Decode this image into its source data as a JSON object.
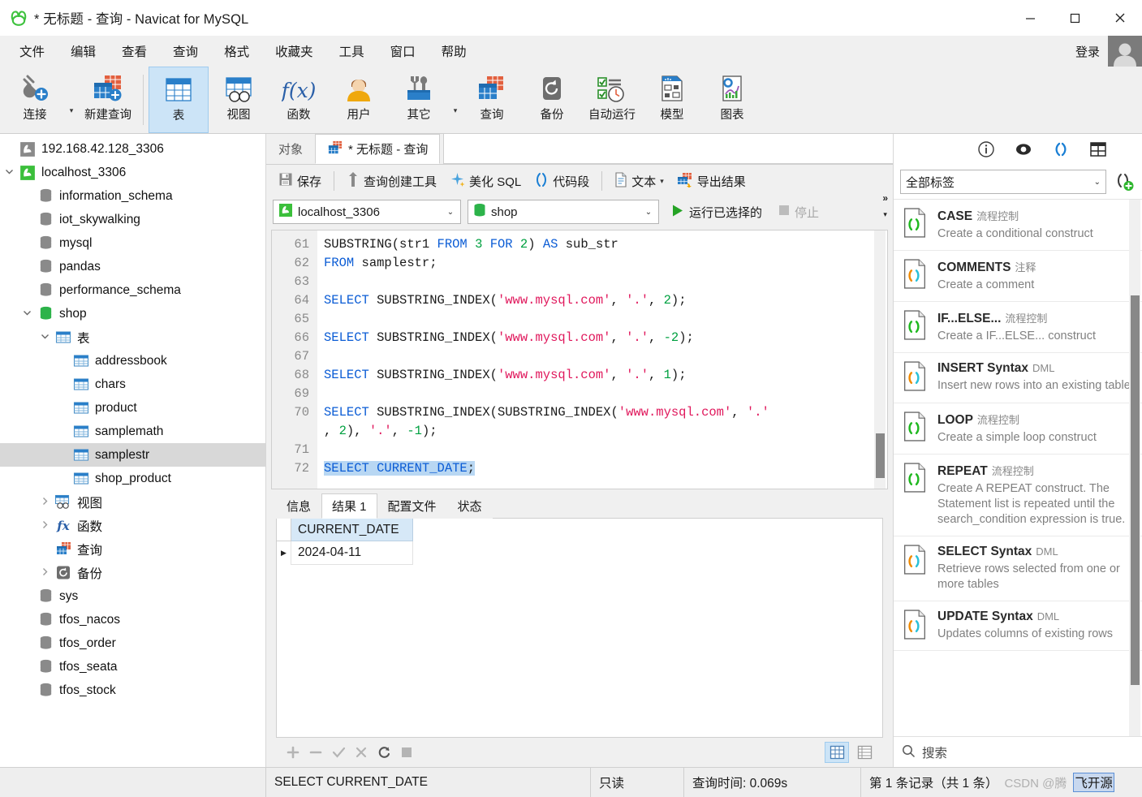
{
  "window": {
    "title": "* 无标题 - 查询 - Navicat for MySQL",
    "minimize": "—",
    "maximize": "□",
    "close": "✕"
  },
  "menubar": {
    "items": [
      "文件",
      "编辑",
      "查看",
      "查询",
      "格式",
      "收藏夹",
      "工具",
      "窗口",
      "帮助"
    ],
    "login_label": "登录"
  },
  "ribbon": {
    "buttons": [
      {
        "label": "连接",
        "icon": "connection-plug-icon"
      },
      {
        "label": "新建查询",
        "icon": "new-query-icon"
      },
      {
        "label": "表",
        "icon": "table-icon"
      },
      {
        "label": "视图",
        "icon": "view-icon"
      },
      {
        "label": "函数",
        "icon": "function-fx-icon"
      },
      {
        "label": "用户",
        "icon": "user-icon"
      },
      {
        "label": "其它",
        "icon": "tools-icon"
      },
      {
        "label": "查询",
        "icon": "query-icon"
      },
      {
        "label": "备份",
        "icon": "backup-icon"
      },
      {
        "label": "自动运行",
        "icon": "automation-icon"
      },
      {
        "label": "模型",
        "icon": "model-icon"
      },
      {
        "label": "图表",
        "icon": "chart-icon"
      }
    ],
    "active": "表"
  },
  "tree": [
    {
      "label": "192.168.42.128_3306",
      "icon": "connection-grey-icon",
      "indent": 0,
      "twist": "",
      "selected": false
    },
    {
      "label": "localhost_3306",
      "icon": "connection-green-icon",
      "indent": 0,
      "twist": "v",
      "selected": false
    },
    {
      "label": "information_schema",
      "icon": "database-grey-icon",
      "indent": 1,
      "twist": "",
      "selected": false
    },
    {
      "label": "iot_skywalking",
      "icon": "database-grey-icon",
      "indent": 1,
      "twist": "",
      "selected": false
    },
    {
      "label": "mysql",
      "icon": "database-grey-icon",
      "indent": 1,
      "twist": "",
      "selected": false
    },
    {
      "label": "pandas",
      "icon": "database-grey-icon",
      "indent": 1,
      "twist": "",
      "selected": false
    },
    {
      "label": "performance_schema",
      "icon": "database-grey-icon",
      "indent": 1,
      "twist": "",
      "selected": false
    },
    {
      "label": "shop",
      "icon": "database-green-icon",
      "indent": 1,
      "twist": "v",
      "selected": false
    },
    {
      "label": "表",
      "icon": "table-folder-icon",
      "indent": 2,
      "twist": "v",
      "selected": false
    },
    {
      "label": "addressbook",
      "icon": "table-blue-icon",
      "indent": 3,
      "twist": "",
      "selected": false
    },
    {
      "label": "chars",
      "icon": "table-blue-icon",
      "indent": 3,
      "twist": "",
      "selected": false
    },
    {
      "label": "product",
      "icon": "table-blue-icon",
      "indent": 3,
      "twist": "",
      "selected": false
    },
    {
      "label": "samplemath",
      "icon": "table-blue-icon",
      "indent": 3,
      "twist": "",
      "selected": false
    },
    {
      "label": "samplestr",
      "icon": "table-blue-icon",
      "indent": 3,
      "twist": "",
      "selected": true
    },
    {
      "label": "shop_product",
      "icon": "table-blue-icon",
      "indent": 3,
      "twist": "",
      "selected": false
    },
    {
      "label": "视图",
      "icon": "view-folder-icon",
      "indent": 2,
      "twist": ">",
      "selected": false
    },
    {
      "label": "函数",
      "icon": "function-folder-icon",
      "indent": 2,
      "twist": ">",
      "selected": false
    },
    {
      "label": "查询",
      "icon": "query-folder-icon",
      "indent": 2,
      "twist": "",
      "selected": false
    },
    {
      "label": "备份",
      "icon": "backup-folder-icon",
      "indent": 2,
      "twist": ">",
      "selected": false
    },
    {
      "label": "sys",
      "icon": "database-grey-icon",
      "indent": 1,
      "twist": "",
      "selected": false
    },
    {
      "label": "tfos_nacos",
      "icon": "database-grey-icon",
      "indent": 1,
      "twist": "",
      "selected": false
    },
    {
      "label": "tfos_order",
      "icon": "database-grey-icon",
      "indent": 1,
      "twist": "",
      "selected": false
    },
    {
      "label": "tfos_seata",
      "icon": "database-grey-icon",
      "indent": 1,
      "twist": "",
      "selected": false
    },
    {
      "label": "tfos_stock",
      "icon": "database-grey-icon",
      "indent": 1,
      "twist": "",
      "selected": false
    }
  ],
  "editor_tabs": {
    "object_tab": "对象",
    "query_tab": "* 无标题 - 查询"
  },
  "query_toolbar": {
    "save": "保存",
    "query_builder": "查询创建工具",
    "beautify_sql": "美化 SQL",
    "code_snippet": "代码段",
    "text": "文本",
    "export_result": "导出结果",
    "more": "»",
    "more_caret": "▾"
  },
  "connection_bar": {
    "connection": "localhost_3306",
    "database": "shop",
    "run_selected": "运行已选择的",
    "stop": "停止"
  },
  "sql_lines": [
    {
      "n": "61",
      "segs": [
        {
          "t": "SUBSTRING(str1 ",
          "c": ""
        },
        {
          "t": "FROM",
          "c": "kw"
        },
        {
          "t": " ",
          "c": ""
        },
        {
          "t": "3",
          "c": "num"
        },
        {
          "t": " ",
          "c": ""
        },
        {
          "t": "FOR",
          "c": "kw"
        },
        {
          "t": " ",
          "c": ""
        },
        {
          "t": "2",
          "c": "num"
        },
        {
          "t": ") ",
          "c": ""
        },
        {
          "t": "AS",
          "c": "kw"
        },
        {
          "t": " sub_str",
          "c": ""
        }
      ]
    },
    {
      "n": "62",
      "segs": [
        {
          "t": "FROM",
          "c": "kw"
        },
        {
          "t": " samplestr;",
          "c": ""
        }
      ]
    },
    {
      "n": "63",
      "segs": []
    },
    {
      "n": "64",
      "segs": [
        {
          "t": "SELECT",
          "c": "kw"
        },
        {
          "t": " SUBSTRING_INDEX(",
          "c": ""
        },
        {
          "t": "'www.mysql.com'",
          "c": "str"
        },
        {
          "t": ", ",
          "c": ""
        },
        {
          "t": "'.'",
          "c": "str"
        },
        {
          "t": ", ",
          "c": ""
        },
        {
          "t": "2",
          "c": "num"
        },
        {
          "t": ");",
          "c": ""
        }
      ]
    },
    {
      "n": "65",
      "segs": []
    },
    {
      "n": "66",
      "segs": [
        {
          "t": "SELECT",
          "c": "kw"
        },
        {
          "t": " SUBSTRING_INDEX(",
          "c": ""
        },
        {
          "t": "'www.mysql.com'",
          "c": "str"
        },
        {
          "t": ", ",
          "c": ""
        },
        {
          "t": "'.'",
          "c": "str"
        },
        {
          "t": ", ",
          "c": ""
        },
        {
          "t": "-2",
          "c": "num"
        },
        {
          "t": ");",
          "c": ""
        }
      ]
    },
    {
      "n": "67",
      "segs": []
    },
    {
      "n": "68",
      "segs": [
        {
          "t": "SELECT",
          "c": "kw"
        },
        {
          "t": " SUBSTRING_INDEX(",
          "c": ""
        },
        {
          "t": "'www.mysql.com'",
          "c": "str"
        },
        {
          "t": ", ",
          "c": ""
        },
        {
          "t": "'.'",
          "c": "str"
        },
        {
          "t": ", ",
          "c": ""
        },
        {
          "t": "1",
          "c": "num"
        },
        {
          "t": ");",
          "c": ""
        }
      ]
    },
    {
      "n": "69",
      "segs": []
    },
    {
      "n": "70",
      "segs": [
        {
          "t": "SELECT",
          "c": "kw"
        },
        {
          "t": " SUBSTRING_INDEX(SUBSTRING_INDEX(",
          "c": ""
        },
        {
          "t": "'www.mysql.com'",
          "c": "str"
        },
        {
          "t": ", ",
          "c": ""
        },
        {
          "t": "'.'",
          "c": "str"
        }
      ]
    },
    {
      "n": "",
      "segs": [
        {
          "t": ", ",
          "c": ""
        },
        {
          "t": "2",
          "c": "num"
        },
        {
          "t": "), ",
          "c": ""
        },
        {
          "t": "'.'",
          "c": "str"
        },
        {
          "t": ", ",
          "c": ""
        },
        {
          "t": "-1",
          "c": "num"
        },
        {
          "t": ");",
          "c": ""
        }
      ]
    },
    {
      "n": "71",
      "segs": []
    },
    {
      "n": "72",
      "segs": [
        {
          "t": "SELECT CURRENT_DATE",
          "c": "kw hl"
        },
        {
          "t": ";",
          "c": "hl"
        }
      ]
    }
  ],
  "result_tabs": {
    "items": [
      "信息",
      "结果 1",
      "配置文件",
      "状态"
    ],
    "active": "结果 1"
  },
  "result_grid": {
    "columns": [
      "CURRENT_DATE"
    ],
    "rows": [
      [
        "2024-04-11"
      ]
    ],
    "row_marker": "▶"
  },
  "grid_toolbar": {
    "add": "+",
    "remove": "−",
    "apply": "✓",
    "cancel": "✕",
    "refresh": "⟳",
    "stop": "■",
    "view_grid": "grid-view-icon",
    "view_form": "form-view-icon"
  },
  "right_panel": {
    "icons": [
      "info-icon",
      "preview-eye-icon",
      "code-snippet-icon",
      "grid-panel-icon"
    ],
    "filter_label": "全部标签",
    "add_snippet": "add-snippet-icon",
    "search_placeholder": "搜索",
    "snippets": [
      {
        "title": "CASE",
        "category": "流程控制",
        "desc": "Create a conditional construct",
        "icon_style": "green"
      },
      {
        "title": "COMMENTS",
        "category": "注释",
        "desc": "Create a comment",
        "icon_style": "multi"
      },
      {
        "title": "IF...ELSE...",
        "category": "流程控制",
        "desc": "Create a IF...ELSE... construct",
        "icon_style": "green"
      },
      {
        "title": "INSERT Syntax",
        "category": "DML",
        "desc": "Insert new rows into an existing table",
        "icon_style": "multi"
      },
      {
        "title": "LOOP",
        "category": "流程控制",
        "desc": "Create a simple loop construct",
        "icon_style": "green"
      },
      {
        "title": "REPEAT",
        "category": "流程控制",
        "desc": "Create A REPEAT construct. The Statement list is repeated until the search_condition expression is true.",
        "icon_style": "green"
      },
      {
        "title": "SELECT Syntax",
        "category": "DML",
        "desc": "Retrieve rows selected from one or more tables",
        "icon_style": "multi"
      },
      {
        "title": "UPDATE Syntax",
        "category": "DML",
        "desc": "Updates columns of existing rows",
        "icon_style": "multi"
      }
    ]
  },
  "statusbar": {
    "sql": "SELECT CURRENT_DATE",
    "readonly": "只读",
    "query_time": "查询时间: 0.069s",
    "record_info": "第 1 条记录（共 1 条）",
    "watermark_prefix": "CSDN @腾",
    "watermark_boxed": "飞开源"
  },
  "colors": {
    "accent": "#cce4f7",
    "accent_border": "#9fcbee",
    "keyword": "#0b5cd5",
    "string": "#e0185c",
    "number": "#00a040",
    "selection": "#b8d7f3",
    "green_db": "#2db34a",
    "toolbar_bg": "#f0f0f0"
  }
}
